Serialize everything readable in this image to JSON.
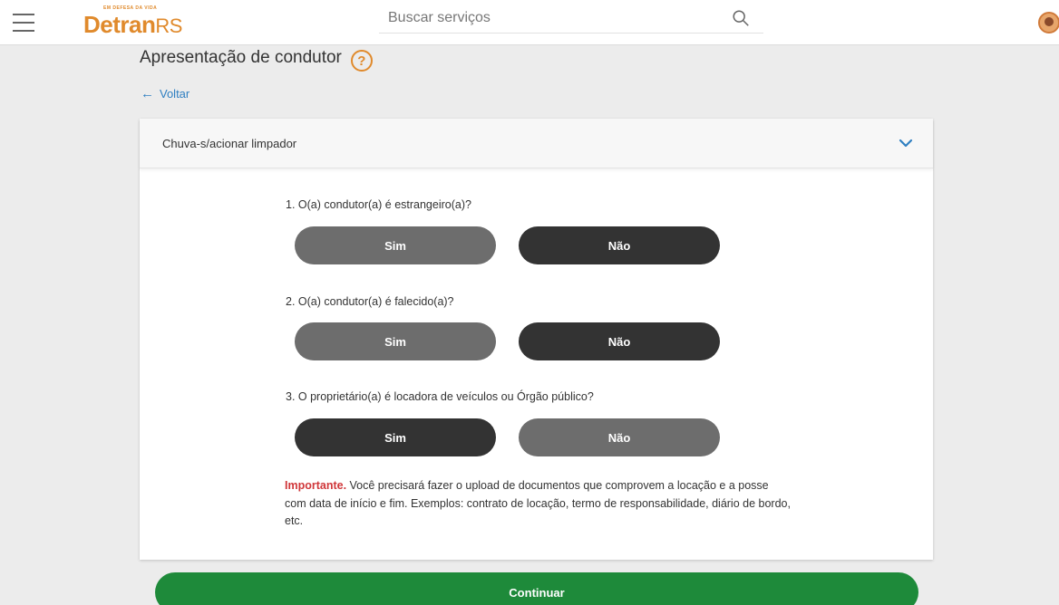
{
  "header": {
    "logo_tagline": "EM DEFESA DA VIDA",
    "logo_main": "Detran",
    "logo_suffix": "RS",
    "search_placeholder": "Buscar serviços"
  },
  "page": {
    "title": "Apresentação de condutor",
    "help_symbol": "?",
    "back_label": "Voltar",
    "back_arrow": "←"
  },
  "card": {
    "header_label": "Chuva-s/acionar limpador",
    "questions": [
      {
        "text": "1. O(a) condutor(a) é estrangeiro(a)?",
        "yes_label": "Sim",
        "no_label": "Não",
        "selected": "Não"
      },
      {
        "text": "2. O(a) condutor(a) é falecido(a)?",
        "yes_label": "Sim",
        "no_label": "Não",
        "selected": "Não"
      },
      {
        "text": "3. O proprietário(a) é locadora de veículos ou Órgão público?",
        "yes_label": "Sim",
        "no_label": "Não",
        "selected": "Sim"
      }
    ],
    "note_important": "Importante.",
    "note_text": " Você precisará fazer o upload de documentos que comprovem a locação e a posse com data de início e fim. Exemplos: contrato de locação, termo de responsabilidade, diário de bordo, etc."
  },
  "footer": {
    "continue_label": "Continuar"
  },
  "colors": {
    "brand_orange": "#e08a2c",
    "link_blue": "#2f7fc1",
    "selected_button": "#333333",
    "unselected_button": "#6d6d6d",
    "important_red": "#d0373a",
    "continue_green": "#1e8a3a"
  }
}
